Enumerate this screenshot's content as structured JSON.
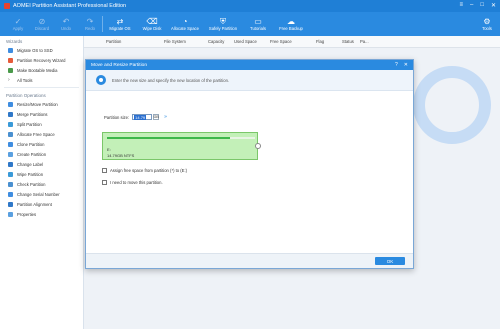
{
  "app": {
    "title": "AOMEI Partition Assistant Professional Edition"
  },
  "toolbar": {
    "items": [
      {
        "label": "Apply",
        "icon": "check-icon",
        "enabled": false
      },
      {
        "label": "Discard",
        "icon": "discard-icon",
        "enabled": false
      },
      {
        "label": "Undo",
        "icon": "undo-icon",
        "enabled": false
      },
      {
        "label": "Redo",
        "icon": "redo-icon",
        "enabled": false
      },
      {
        "label": "Migrate OS",
        "icon": "migrate-icon",
        "enabled": true
      },
      {
        "label": "Wipe Disk",
        "icon": "wipe-icon",
        "enabled": true
      },
      {
        "label": "Allocate Space",
        "icon": "allocate-icon",
        "enabled": true
      },
      {
        "label": "Safely Partition",
        "icon": "safe-icon",
        "enabled": true
      },
      {
        "label": "Tutorials",
        "icon": "tutorial-icon",
        "enabled": true
      },
      {
        "label": "Free Backup",
        "icon": "backup-icon",
        "enabled": true
      },
      {
        "label": "Tools",
        "icon": "tools-icon",
        "enabled": true
      }
    ]
  },
  "table": {
    "columns": [
      "Partition",
      "File System",
      "Capacity",
      "Used Space",
      "Free Space",
      "Flag",
      "Status",
      "Pa..."
    ]
  },
  "sidebar": {
    "wizards_heading": "Wizards",
    "wizards": [
      {
        "label": "Migrate OS to SSD",
        "icon": "migrate-icon"
      },
      {
        "label": "Partition Recovery Wizard",
        "icon": "recovery-icon"
      },
      {
        "label": "Make Bootable Media",
        "icon": "media-icon"
      },
      {
        "label": "All Tools",
        "icon": "chevron-icon"
      }
    ],
    "ops_heading": "Partition Operations",
    "operations": [
      {
        "label": "Resize/Move Partition",
        "icon": "resize-icon"
      },
      {
        "label": "Merge Partitions",
        "icon": "merge-icon"
      },
      {
        "label": "Split Partition",
        "icon": "split-icon"
      },
      {
        "label": "Allocate Free Space",
        "icon": "allocate-icon"
      },
      {
        "label": "Clone Partition",
        "icon": "clone-icon"
      },
      {
        "label": "Create Partition",
        "icon": "create-icon"
      },
      {
        "label": "Change Label",
        "icon": "label-icon"
      },
      {
        "label": "Wipe Partition",
        "icon": "wipe-icon"
      },
      {
        "label": "Check Partition",
        "icon": "check-icon"
      },
      {
        "label": "Change Serial Number",
        "icon": "serial-icon"
      },
      {
        "label": "Partition Alignment",
        "icon": "align-icon"
      },
      {
        "label": "Properties",
        "icon": "properties-icon"
      }
    ]
  },
  "dialog": {
    "title": "Move and Resize Partition",
    "description": "Enter the new size and specify the new location of the partition.",
    "size_label": "Partition size:",
    "size_value": "14.79",
    "size_unit": "GB",
    "partition_letter": "E:",
    "partition_info": "14.79GB NTFS",
    "used_fraction": 0.83,
    "assign_label": "Assign free space from partition (*) to (E:)",
    "move_label": "I need to move this partition.",
    "ok_label": "OK"
  },
  "colors": {
    "accent": "#2a8ae0",
    "partition_fill": "#c3f0b8",
    "used_bar": "#3db84a"
  }
}
